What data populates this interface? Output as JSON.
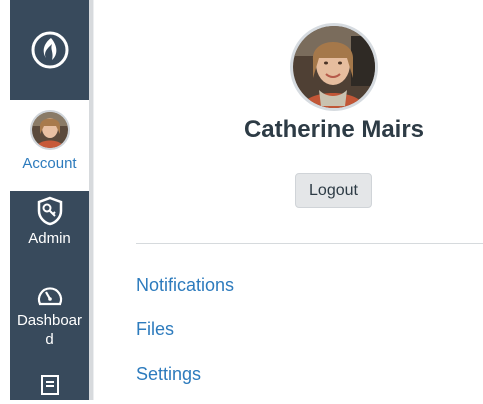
{
  "nav": {
    "account_label": "Account",
    "admin_label": "Admin",
    "dashboard_label": "Dashboar\nd",
    "icons": {
      "logo": "canvas-flame-logo",
      "admin": "shield-key-icon",
      "dashboard": "speedometer-icon",
      "courses": "book-icon"
    }
  },
  "profile": {
    "name": "Catherine Mairs",
    "logout_label": "Logout"
  },
  "links": [
    {
      "label": "Notifications"
    },
    {
      "label": "Files"
    },
    {
      "label": "Settings"
    }
  ],
  "colors": {
    "nav_bg": "#384a5c",
    "link": "#2d7bbd",
    "name_text": "#2d3b45"
  }
}
